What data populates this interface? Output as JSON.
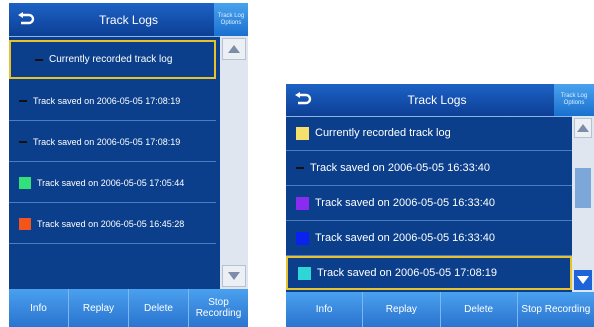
{
  "screens": [
    {
      "title": "Track Logs",
      "options_label": "Track Log Options",
      "rows": [
        {
          "label": "Currently recorded track log",
          "swatch": "none",
          "selected": true
        },
        {
          "label": "Track saved on 2006-05-05 17:08:19",
          "swatch": "dash",
          "selected": false
        },
        {
          "label": "Track saved on 2006-05-05 17:08:19",
          "swatch": "dash",
          "selected": false
        },
        {
          "label": "Track saved on 2006-05-05 17:05:44",
          "swatch": "#33e07a",
          "selected": false
        },
        {
          "label": "Track saved on 2006-05-05 16:45:28",
          "swatch": "#f2541b",
          "selected": false
        }
      ],
      "buttons": [
        "Info",
        "Replay",
        "Delete",
        "Stop Recording"
      ]
    },
    {
      "title": "Track Logs",
      "options_label": "Track Log Options",
      "rows": [
        {
          "label": "Currently recorded track log",
          "swatch": "#f4e06a",
          "selected": false
        },
        {
          "label": "Track saved on 2006-05-05 16:33:40",
          "swatch": "dash",
          "selected": false
        },
        {
          "label": "Track saved on 2006-05-05 16:33:40",
          "swatch": "#8a2bf0",
          "selected": false
        },
        {
          "label": "Track saved on 2006-05-05 16:33:40",
          "swatch": "#0a22ee",
          "selected": false
        },
        {
          "label": "Track saved on 2006-05-05 17:08:19",
          "swatch": "#2fd6d6",
          "selected": true
        }
      ],
      "buttons": [
        "Info",
        "Replay",
        "Delete",
        "Stop Recording"
      ]
    }
  ],
  "icons": {
    "back": "back-arrow-icon",
    "scroll_up": "scroll-up-arrow-icon",
    "scroll_down": "scroll-down-arrow-icon"
  },
  "colors": {
    "background": "#0b3f8c",
    "selection_border": "#e8c22b",
    "button_bar": "#3a8ee6"
  }
}
